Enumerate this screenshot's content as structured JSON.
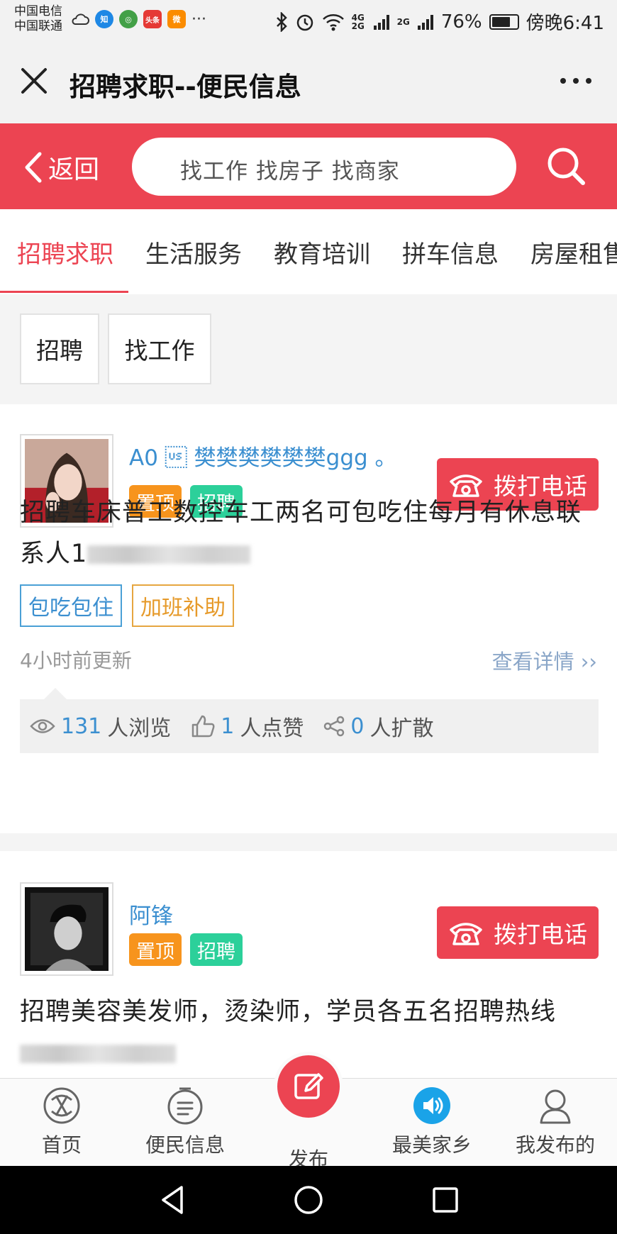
{
  "status_bar": {
    "carrier_1": "中国电信",
    "carrier_2": "中国联通",
    "network": "4G 2G",
    "network_2": "2G",
    "battery": "76%",
    "battery_level": 0.76,
    "time": "傍晚6:41",
    "more_notifications": "···",
    "apps": [
      {
        "name": "zhihu-icon",
        "label": "知",
        "color": "#1e88e5"
      },
      {
        "name": "browser-icon",
        "label": "◎",
        "color": "#43a047"
      },
      {
        "name": "toutiao-icon",
        "label": "头条",
        "color": "#e53935"
      },
      {
        "name": "weibo-icon",
        "label": "微",
        "color": "#fb8c00"
      }
    ]
  },
  "title_bar": {
    "title": "招聘求职--便民信息"
  },
  "header": {
    "back_label": "返回",
    "search_placeholder": "找工作 找房子 找商家"
  },
  "tabs": [
    {
      "label": "招聘求职",
      "active": true
    },
    {
      "label": "生活服务",
      "active": false
    },
    {
      "label": "教育培训",
      "active": false
    },
    {
      "label": "拼车信息",
      "active": false
    },
    {
      "label": "房屋租售",
      "active": false
    }
  ],
  "filters": [
    {
      "label": "招聘"
    },
    {
      "label": "找工作"
    }
  ],
  "posts": [
    {
      "username": "A0 \u001f 樊樊樊樊樊樊ggg 。",
      "badges": [
        "置顶",
        "招聘"
      ],
      "call_label": "拨打电话",
      "text": "招聘车床普工数控车工两名可包吃住每月有休息联系人1",
      "tags": [
        "包吃包住",
        "加班补助"
      ],
      "updated": "4小时前更新",
      "detail_label": "查看详情 ››",
      "views": "131",
      "views_label": "人浏览",
      "likes": "1",
      "likes_label": "人点赞",
      "shares": "0",
      "shares_label": "人扩散"
    },
    {
      "username": "阿锋",
      "badges": [
        "置顶",
        "招聘"
      ],
      "call_label": "拨打电话",
      "text": "招聘美容美发师，烫染师，学员各五名招聘热线"
    }
  ],
  "bottom_nav": {
    "home": "首页",
    "info": "便民信息",
    "publish": "发布",
    "hometown": "最美家乡",
    "mine": "我发布的"
  },
  "colors": {
    "brand_red": "#ec4452",
    "link_blue": "#3b8fd0",
    "badge_orange": "#f7941d",
    "badge_green": "#2cd09a"
  }
}
